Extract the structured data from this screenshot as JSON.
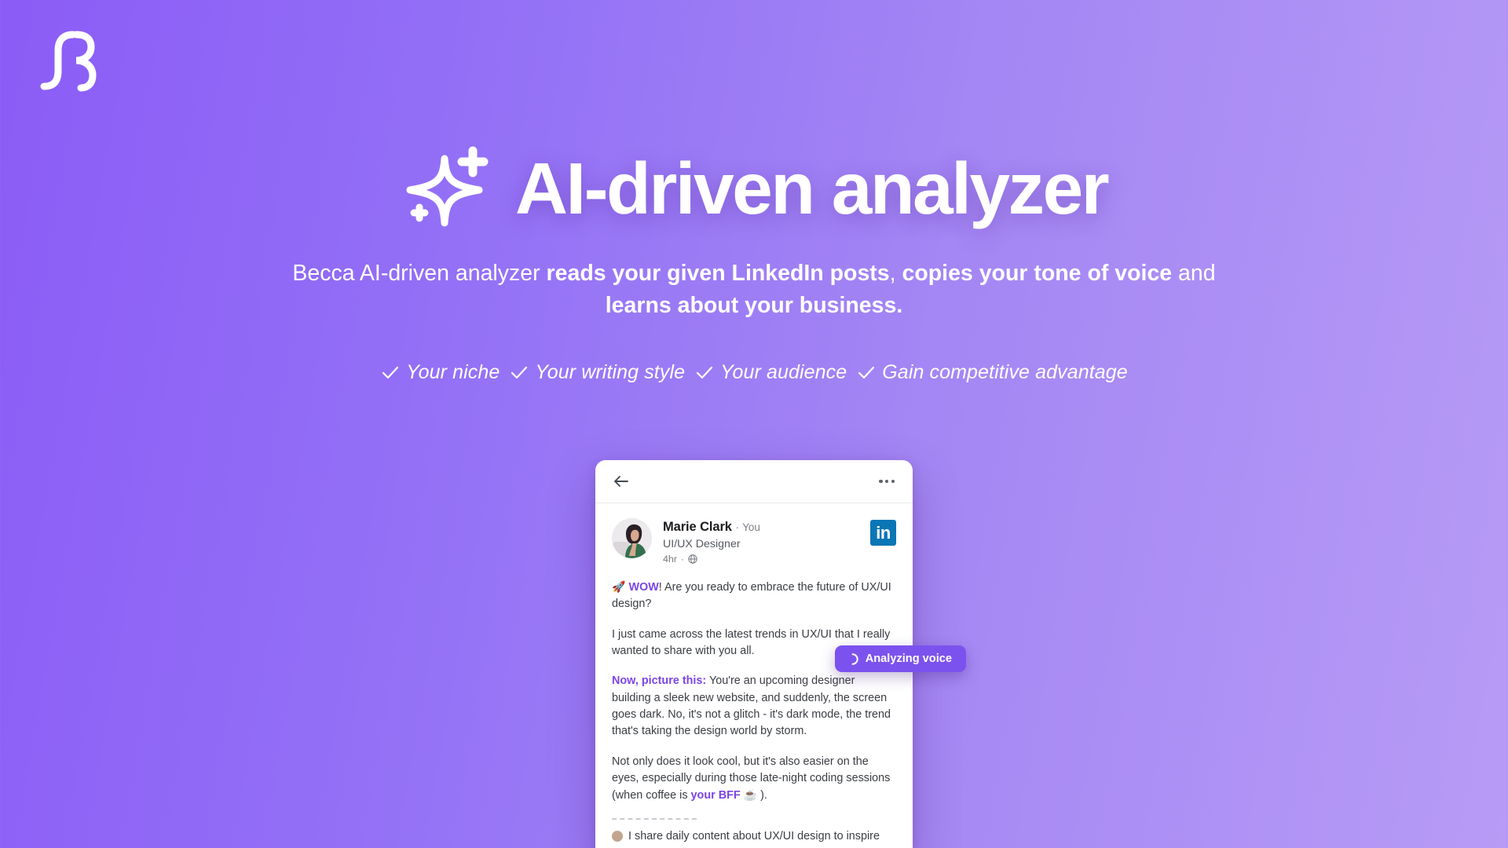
{
  "brand": {
    "logo_icon": "becca-monogram-logo"
  },
  "hero": {
    "sparkle_icon": "sparkle-star-icon",
    "headline": "AI-driven analyzer",
    "subtitle": {
      "part1": "Becca AI-driven analyzer ",
      "bold1": "reads your given LinkedIn posts",
      "part2": ", ",
      "bold2": "copies your tone of voice",
      "part3": " and ",
      "bold3": "learns about your business."
    },
    "features": [
      {
        "check_icon": "check-icon",
        "label": "Your niche"
      },
      {
        "check_icon": "check-icon",
        "label": "Your writing style"
      },
      {
        "check_icon": "check-icon",
        "label": "Your audience"
      },
      {
        "check_icon": "check-icon",
        "label": "Gain competitive advantage"
      }
    ]
  },
  "post_card": {
    "back_icon": "back-arrow-icon",
    "more_icon": "more-options-icon",
    "avatar_icon": "user-avatar",
    "author": "Marie Clark",
    "separator": "·",
    "relationship": "You",
    "role": "UI/UX Designer",
    "time": "4hr",
    "meta_separator": "·",
    "visibility_icon": "globe-icon",
    "network_logo": "linkedin-logo",
    "network_logo_text": "in",
    "body": {
      "p1_emoji": "🚀",
      "p1_highlight": "WOW",
      "p1_rest": "! Are you ready to embrace the future of UX/UI design?",
      "p2": "I just came across the latest trends in UX/UI that I really wanted to share with you all.",
      "p3_highlight": "Now, picture this:",
      "p3_rest": " You're an upcoming designer building a sleek new website, and suddenly, the screen goes dark. No, it's not a glitch - it's dark mode, the trend that's taking the design world by storm.",
      "p4_start": "Not only does it look cool, but it's also easier on the eyes, especially during those late-night coding sessions (when coffee is ",
      "p4_highlight": "your BFF",
      "p4_emoji": "☕",
      "p4_end": " )."
    },
    "footer_line": "I share daily content about UX/UI design to inspire"
  },
  "badge": {
    "spinner_icon": "loading-spinner-icon",
    "label": "Analyzing voice"
  },
  "colors": {
    "bg_start": "#8B5CF6",
    "bg_end": "#B79BF5",
    "accent": "#7C52EE",
    "highlight": "#7b45e8",
    "linkedin_blue": "#0A76B5"
  }
}
